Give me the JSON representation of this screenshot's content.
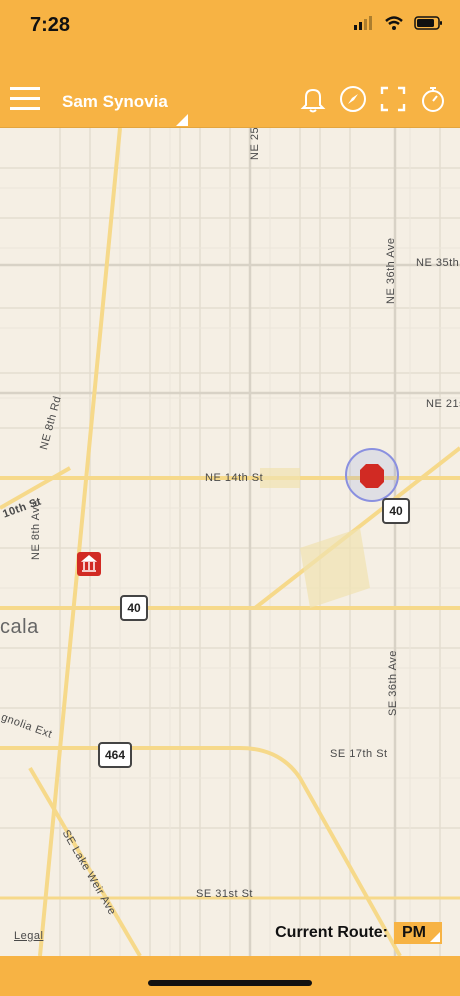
{
  "status": {
    "time": "7:28"
  },
  "header": {
    "user_name": "Sam Synovia"
  },
  "map": {
    "streets": [
      {
        "text": "NE 25"
      },
      {
        "text": "NE 36th Ave"
      },
      {
        "text": "NE 35th"
      },
      {
        "text": "NE 21s"
      },
      {
        "text": "NE 8th Rd"
      },
      {
        "text": "NE 14th St"
      },
      {
        "text": "10th St"
      },
      {
        "text": "NE 8th Ave"
      },
      {
        "text": "cala"
      },
      {
        "text": "SE 36th Ave"
      },
      {
        "text": "SE 17th St"
      },
      {
        "text": "gnolia Ext"
      },
      {
        "text": "SE Lake Weir Ave"
      },
      {
        "text": "SE 31st St"
      }
    ],
    "shields": [
      "40",
      "40",
      "464"
    ],
    "legal": "Legal"
  },
  "route": {
    "label": "Current Route:",
    "value": "PM"
  }
}
